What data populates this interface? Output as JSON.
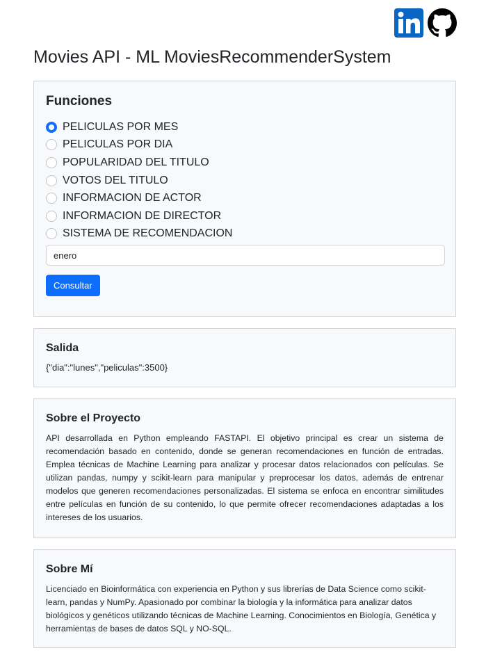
{
  "social": {
    "linkedin_icon": "linkedin-icon",
    "github_icon": "github-icon",
    "linkedin_color": "#0a66c2",
    "github_color": "#000000"
  },
  "header": {
    "title": "Movies API - ML MoviesRecommenderSystem"
  },
  "funciones": {
    "title": "Funciones",
    "options": [
      {
        "label": "PELICULAS POR MES",
        "checked": true
      },
      {
        "label": "PELICULAS POR DIA",
        "checked": false
      },
      {
        "label": "POPULARIDAD DEL TITULO",
        "checked": false
      },
      {
        "label": "VOTOS DEL TITULO",
        "checked": false
      },
      {
        "label": "INFORMACION DE ACTOR",
        "checked": false
      },
      {
        "label": "INFORMACION DE DIRECTOR",
        "checked": false
      },
      {
        "label": "SISTEMA DE RECOMENDACION",
        "checked": false
      }
    ],
    "input_value": "enero",
    "button_label": "Consultar",
    "accent_color": "#0d6efd"
  },
  "salida": {
    "title": "Salida",
    "output": "{\"dia\":\"lunes\",\"peliculas\":3500}"
  },
  "proyecto": {
    "title": "Sobre el Proyecto",
    "text": "API desarrollada en Python empleando FASTAPI. El objetivo principal es crear un sistema de recomendación basado en contenido, donde se generan recomendaciones en función de entradas. Emplea técnicas de Machine Learning para analizar y procesar datos relacionados con películas. Se utilizan pandas, numpy y scikit-learn para manipular y preprocesar los datos, además de entrenar modelos que generen recomendaciones personalizadas. El sistema se enfoca en encontrar similitudes entre películas en función de su contenido, lo que permite ofrecer recomendaciones adaptadas a los intereses de los usuarios."
  },
  "sobre_mi": {
    "title": "Sobre Mí",
    "text": "Licenciado en Bioinformática con experiencia en Python y sus librerías de Data Science como scikit-learn, pandas y NumPy. Apasionado por combinar la biología y la informática para analizar datos biológicos y genéticos utilizando técnicas de Machine Learning. Conocimientos en Biología, Genética y herramientas de bases de datos SQL y NO-SQL."
  }
}
